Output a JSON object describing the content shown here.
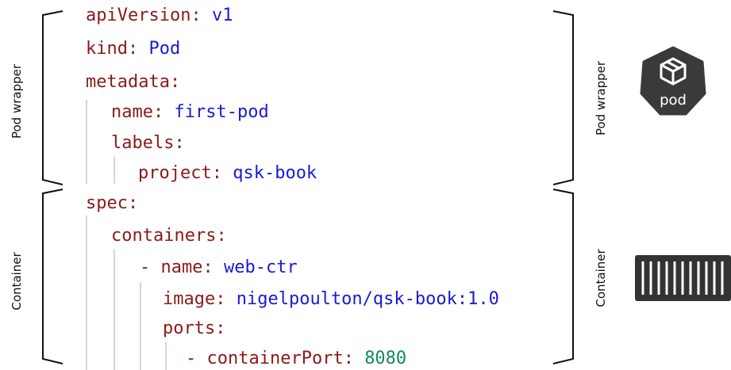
{
  "labels": {
    "left_top": "Pod wrapper",
    "left_bottom": "Container",
    "right_top": "Pod wrapper",
    "right_bottom": "Container"
  },
  "pod_icon": {
    "icon": "kubernetes-pod-cube-icon",
    "text": "pod",
    "color": "#3a3a3a"
  },
  "container_icon": {
    "icon": "shipping-container-icon",
    "color": "#333333"
  },
  "colors": {
    "key": "#8b1a1a",
    "value": "#1a1ad6",
    "number": "#128a5c",
    "guide": "#d6d6d6"
  },
  "yaml": [
    {
      "key": "apiVersion",
      "value": "v1"
    },
    {
      "key": "kind",
      "value": "Pod"
    },
    {
      "key": "metadata",
      "value": ""
    },
    {
      "key": "name",
      "value": "first-pod"
    },
    {
      "key": "labels",
      "value": ""
    },
    {
      "key": "project",
      "value": "qsk-book"
    },
    {
      "key": "spec",
      "value": ""
    },
    {
      "key": "containers",
      "value": ""
    },
    {
      "dash": "- ",
      "key": "name",
      "value": "web-ctr"
    },
    {
      "key": "image",
      "value": "nigelpoulton/qsk-book:1.0"
    },
    {
      "key": "ports",
      "value": ""
    },
    {
      "dash": "- ",
      "key": "containerPort",
      "value": "8080"
    }
  ]
}
